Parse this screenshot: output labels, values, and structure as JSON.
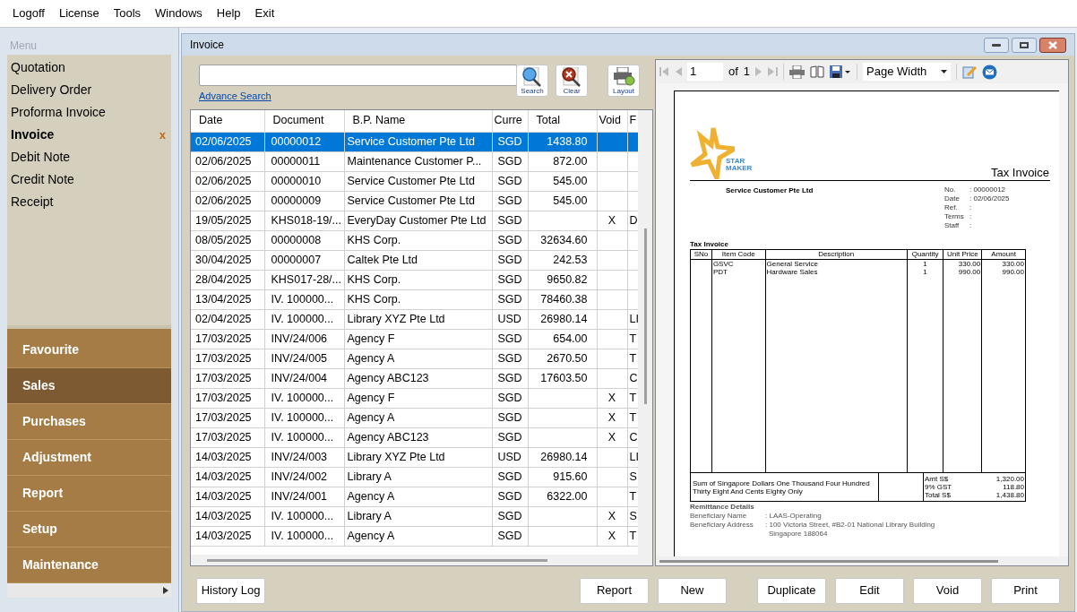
{
  "menu_bar": [
    "Logoff",
    "License",
    "Tools",
    "Windows",
    "Help",
    "Exit"
  ],
  "sidebar": {
    "title": "Menu",
    "items": [
      {
        "label": "Quotation",
        "selected": false
      },
      {
        "label": "Delivery Order",
        "selected": false
      },
      {
        "label": "Proforma Invoice",
        "selected": false
      },
      {
        "label": "Invoice",
        "selected": true,
        "close": "x"
      },
      {
        "label": "Debit Note",
        "selected": false
      },
      {
        "label": "Credit Note",
        "selected": false
      },
      {
        "label": "Receipt",
        "selected": false
      }
    ],
    "sections": [
      {
        "label": "Favourite",
        "selected": false
      },
      {
        "label": "Sales",
        "selected": true
      },
      {
        "label": "Purchases",
        "selected": false
      },
      {
        "label": "Adjustment",
        "selected": false
      },
      {
        "label": "Report",
        "selected": false
      },
      {
        "label": "Setup",
        "selected": false
      },
      {
        "label": "Maintenance",
        "selected": false
      }
    ]
  },
  "window": {
    "title": "Invoice"
  },
  "search": {
    "link": "Advance Search",
    "buttons": [
      {
        "kind": "search",
        "label": "Search"
      },
      {
        "kind": "clear",
        "label": "Clear"
      },
      {
        "kind": "layout",
        "label": "Layout"
      }
    ]
  },
  "table": {
    "columns": [
      "Date",
      "Document",
      "B.P. Name",
      "Curre",
      "Total",
      "Void",
      "F"
    ],
    "rows": [
      {
        "date": "02/06/2025",
        "document": "00000012",
        "bp_name": "Service Customer Pte Ltd",
        "currency": "SGD",
        "total": "1438.80",
        "selected": true
      },
      {
        "date": "02/06/2025",
        "document": "00000011",
        "bp_name": "Maintenance Customer P...",
        "currency": "SGD",
        "total": "872.00",
        "selected": false
      },
      {
        "date": "02/06/2025",
        "document": "00000010",
        "bp_name": "Service Customer Pte Ltd",
        "currency": "SGD",
        "total": "545.00",
        "selected": false
      },
      {
        "date": "02/06/2025",
        "document": "00000009",
        "bp_name": "Service Customer Pte Ltd",
        "currency": "SGD",
        "total": "545.00",
        "selected": false
      },
      {
        "date": "19/05/2025",
        "document": "KHS018-19/...",
        "bp_name": "EveryDay Customer Pte Ltd",
        "currency": "SGD",
        "void": "X",
        "column_7": "D",
        "selected": false
      },
      {
        "date": "08/05/2025",
        "document": "00000008",
        "bp_name": "KHS Corp.",
        "currency": "SGD",
        "total": "32634.60",
        "selected": false
      },
      {
        "date": "30/04/2025",
        "document": "00000007",
        "bp_name": "Caltek Pte Ltd",
        "currency": "SGD",
        "total": "242.53",
        "selected": false
      },
      {
        "date": "28/04/2025",
        "document": "KHS017-28/...",
        "bp_name": "KHS Corp.",
        "currency": "SGD",
        "total": "9650.82",
        "selected": false
      },
      {
        "date": "13/04/2025",
        "document": "IV. 100000...",
        "bp_name": "KHS Corp.",
        "currency": "SGD",
        "total": "78460.38",
        "selected": false
      },
      {
        "date": "02/04/2025",
        "document": "IV. 100000...",
        "bp_name": "Library XYZ Pte Ltd",
        "currency": "USD",
        "total": "26980.14",
        "column_7": "LI",
        "selected": false
      },
      {
        "date": "17/03/2025",
        "document": "INV/24/006",
        "bp_name": "Agency F",
        "currency": "SGD",
        "total": "654.00",
        "column_7": "T",
        "selected": false
      },
      {
        "date": "17/03/2025",
        "document": "INV/24/005",
        "bp_name": "Agency A",
        "currency": "SGD",
        "total": "2670.50",
        "column_7": "T",
        "selected": false
      },
      {
        "date": "17/03/2025",
        "document": "INV/24/004",
        "bp_name": "Agency ABC123",
        "currency": "SGD",
        "total": "17603.50",
        "column_7": "C",
        "selected": false
      },
      {
        "date": "17/03/2025",
        "document": "IV. 100000...",
        "bp_name": "Agency F",
        "currency": "SGD",
        "void": "X",
        "column_7": "T",
        "selected": false
      },
      {
        "date": "17/03/2025",
        "document": "IV. 100000...",
        "bp_name": "Agency A",
        "currency": "SGD",
        "void": "X",
        "column_7": "T",
        "selected": false
      },
      {
        "date": "17/03/2025",
        "document": "IV. 100000...",
        "bp_name": "Agency ABC123",
        "currency": "SGD",
        "void": "X",
        "column_7": "C",
        "selected": false
      },
      {
        "date": "14/03/2025",
        "document": "INV/24/003",
        "bp_name": "Library XYZ Pte Ltd",
        "currency": "USD",
        "total": "26980.14",
        "column_7": "LI",
        "selected": false
      },
      {
        "date": "14/03/2025",
        "document": "INV/24/002",
        "bp_name": "Library A",
        "currency": "SGD",
        "total": "915.60",
        "column_7": "S",
        "selected": false
      },
      {
        "date": "14/03/2025",
        "document": "INV/24/001",
        "bp_name": "Agency A",
        "currency": "SGD",
        "total": "6322.00",
        "column_7": "T",
        "selected": false
      },
      {
        "date": "14/03/2025",
        "document": "IV. 100000...",
        "bp_name": "Library A",
        "currency": "SGD",
        "void": "X",
        "column_7": "S",
        "selected": false
      },
      {
        "date": "14/03/2025",
        "document": "IV. 100000...",
        "bp_name": "Agency A",
        "currency": "SGD",
        "void": "X",
        "column_7": "T",
        "selected": false
      }
    ]
  },
  "viewer": {
    "page": "1",
    "of": "of",
    "page_count": "1",
    "zoom": "Page Width"
  },
  "document": {
    "logo": [
      "STAR",
      "MAKER"
    ],
    "title": "Tax Invoice",
    "customer": "Service Customer Pte Ltd",
    "fields": [
      {
        "label": "No.",
        "value": ": 00000012"
      },
      {
        "label": "Date",
        "value": ": 02/06/2025"
      },
      {
        "label": "Ref.",
        "value": ":"
      },
      {
        "label": "Terms",
        "value": ":"
      },
      {
        "label": "Staff",
        "value": ":"
      }
    ],
    "section_title": "Tax Invoice",
    "columns": [
      "SNo",
      "Item Code",
      "Description",
      "Quantity",
      "Unit Price",
      "Amount"
    ],
    "lines": [
      {
        "item_code": "GSVC",
        "description": "General Service",
        "quantity": "1",
        "unit_price": "330.00",
        "amount": "330.00"
      },
      {
        "item_code": "PDT",
        "description": "Hardware Sales",
        "quantity": "1",
        "unit_price": "990.00",
        "amount": "990.00"
      }
    ],
    "amount_in_words": "Sum of Singapore Dollars One Thousand Four Hundred Thirty Eight And Cents Eighty Only",
    "totals": [
      {
        "label": "Amt S$",
        "value": "1,320.00"
      },
      {
        "label": "9% GST",
        "value": "118.80"
      },
      {
        "label": "Total S$",
        "value": "1,438.80"
      }
    ],
    "remittance_title": "Remittance Details",
    "remittance": [
      {
        "label": "Beneficiary Name",
        "value": ": LAAS-Operating"
      },
      {
        "label": "Beneficiary Address",
        "value": ": 100 Victoria Street, #B2-01 National Library Building",
        "extra": "Singapore 188064"
      }
    ]
  },
  "footer_buttons": {
    "left": [
      "History Log"
    ],
    "right": [
      "Report",
      "New",
      "Duplicate",
      "Edit",
      "Void",
      "Print"
    ]
  }
}
